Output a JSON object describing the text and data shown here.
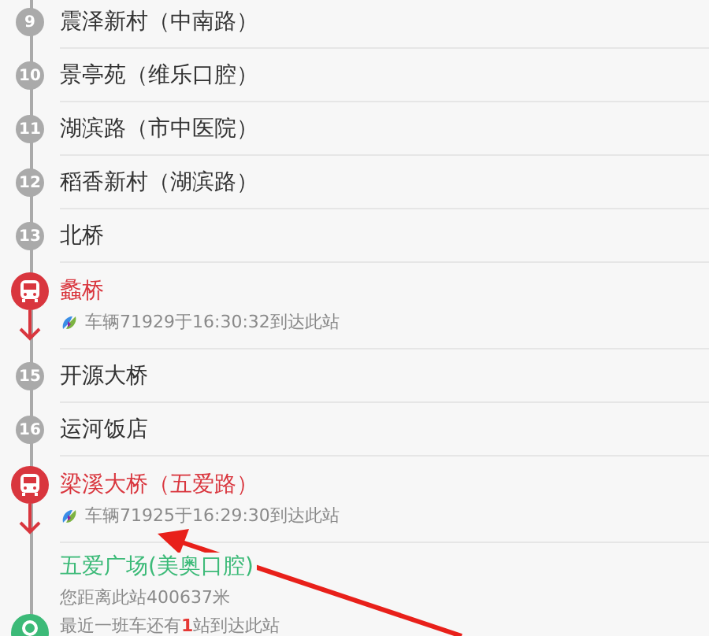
{
  "stations": [
    {
      "kind": "stop",
      "number": "9",
      "name": "震泽新村（中南路）"
    },
    {
      "kind": "stop",
      "number": "10",
      "name": "景亭苑（维乐口腔）"
    },
    {
      "kind": "stop",
      "number": "11",
      "name": "湖滨路（市中医院）"
    },
    {
      "kind": "stop",
      "number": "12",
      "name": "稻香新村（湖滨路）"
    },
    {
      "kind": "stop",
      "number": "13",
      "name": "北桥"
    },
    {
      "kind": "bus",
      "name": "蠡桥",
      "info": "车辆71929于16:30:32到达此站"
    },
    {
      "kind": "stop",
      "number": "15",
      "name": "开源大桥"
    },
    {
      "kind": "stop",
      "number": "16",
      "name": "运河饭店"
    },
    {
      "kind": "bus",
      "name": "梁溪大桥（五爱路）",
      "info": "车辆71925于16:29:30到达此站"
    },
    {
      "kind": "current",
      "name": "五爱广场(美奥口腔)",
      "lines": [
        "您距离此站400637米",
        "最近一班车还有**1**站到达此站"
      ]
    }
  ]
}
